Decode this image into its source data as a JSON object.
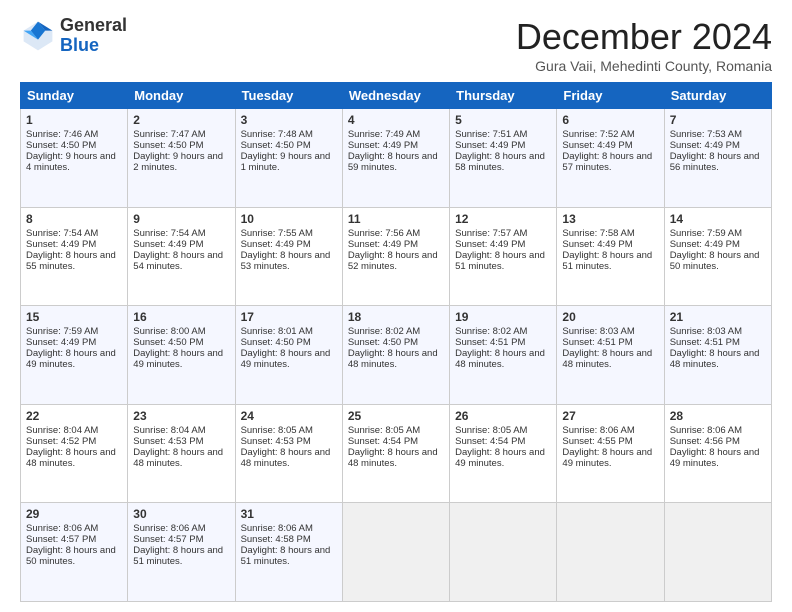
{
  "header": {
    "logo_general": "General",
    "logo_blue": "Blue",
    "month_title": "December 2024",
    "subtitle": "Gura Vaii, Mehedinti County, Romania"
  },
  "weekdays": [
    "Sunday",
    "Monday",
    "Tuesday",
    "Wednesday",
    "Thursday",
    "Friday",
    "Saturday"
  ],
  "weeks": [
    [
      {
        "day": "1",
        "sunrise": "Sunrise: 7:46 AM",
        "sunset": "Sunset: 4:50 PM",
        "daylight": "Daylight: 9 hours and 4 minutes."
      },
      {
        "day": "2",
        "sunrise": "Sunrise: 7:47 AM",
        "sunset": "Sunset: 4:50 PM",
        "daylight": "Daylight: 9 hours and 2 minutes."
      },
      {
        "day": "3",
        "sunrise": "Sunrise: 7:48 AM",
        "sunset": "Sunset: 4:50 PM",
        "daylight": "Daylight: 9 hours and 1 minute."
      },
      {
        "day": "4",
        "sunrise": "Sunrise: 7:49 AM",
        "sunset": "Sunset: 4:49 PM",
        "daylight": "Daylight: 8 hours and 59 minutes."
      },
      {
        "day": "5",
        "sunrise": "Sunrise: 7:51 AM",
        "sunset": "Sunset: 4:49 PM",
        "daylight": "Daylight: 8 hours and 58 minutes."
      },
      {
        "day": "6",
        "sunrise": "Sunrise: 7:52 AM",
        "sunset": "Sunset: 4:49 PM",
        "daylight": "Daylight: 8 hours and 57 minutes."
      },
      {
        "day": "7",
        "sunrise": "Sunrise: 7:53 AM",
        "sunset": "Sunset: 4:49 PM",
        "daylight": "Daylight: 8 hours and 56 minutes."
      }
    ],
    [
      {
        "day": "8",
        "sunrise": "Sunrise: 7:54 AM",
        "sunset": "Sunset: 4:49 PM",
        "daylight": "Daylight: 8 hours and 55 minutes."
      },
      {
        "day": "9",
        "sunrise": "Sunrise: 7:54 AM",
        "sunset": "Sunset: 4:49 PM",
        "daylight": "Daylight: 8 hours and 54 minutes."
      },
      {
        "day": "10",
        "sunrise": "Sunrise: 7:55 AM",
        "sunset": "Sunset: 4:49 PM",
        "daylight": "Daylight: 8 hours and 53 minutes."
      },
      {
        "day": "11",
        "sunrise": "Sunrise: 7:56 AM",
        "sunset": "Sunset: 4:49 PM",
        "daylight": "Daylight: 8 hours and 52 minutes."
      },
      {
        "day": "12",
        "sunrise": "Sunrise: 7:57 AM",
        "sunset": "Sunset: 4:49 PM",
        "daylight": "Daylight: 8 hours and 51 minutes."
      },
      {
        "day": "13",
        "sunrise": "Sunrise: 7:58 AM",
        "sunset": "Sunset: 4:49 PM",
        "daylight": "Daylight: 8 hours and 51 minutes."
      },
      {
        "day": "14",
        "sunrise": "Sunrise: 7:59 AM",
        "sunset": "Sunset: 4:49 PM",
        "daylight": "Daylight: 8 hours and 50 minutes."
      }
    ],
    [
      {
        "day": "15",
        "sunrise": "Sunrise: 7:59 AM",
        "sunset": "Sunset: 4:49 PM",
        "daylight": "Daylight: 8 hours and 49 minutes."
      },
      {
        "day": "16",
        "sunrise": "Sunrise: 8:00 AM",
        "sunset": "Sunset: 4:50 PM",
        "daylight": "Daylight: 8 hours and 49 minutes."
      },
      {
        "day": "17",
        "sunrise": "Sunrise: 8:01 AM",
        "sunset": "Sunset: 4:50 PM",
        "daylight": "Daylight: 8 hours and 49 minutes."
      },
      {
        "day": "18",
        "sunrise": "Sunrise: 8:02 AM",
        "sunset": "Sunset: 4:50 PM",
        "daylight": "Daylight: 8 hours and 48 minutes."
      },
      {
        "day": "19",
        "sunrise": "Sunrise: 8:02 AM",
        "sunset": "Sunset: 4:51 PM",
        "daylight": "Daylight: 8 hours and 48 minutes."
      },
      {
        "day": "20",
        "sunrise": "Sunrise: 8:03 AM",
        "sunset": "Sunset: 4:51 PM",
        "daylight": "Daylight: 8 hours and 48 minutes."
      },
      {
        "day": "21",
        "sunrise": "Sunrise: 8:03 AM",
        "sunset": "Sunset: 4:51 PM",
        "daylight": "Daylight: 8 hours and 48 minutes."
      }
    ],
    [
      {
        "day": "22",
        "sunrise": "Sunrise: 8:04 AM",
        "sunset": "Sunset: 4:52 PM",
        "daylight": "Daylight: 8 hours and 48 minutes."
      },
      {
        "day": "23",
        "sunrise": "Sunrise: 8:04 AM",
        "sunset": "Sunset: 4:53 PM",
        "daylight": "Daylight: 8 hours and 48 minutes."
      },
      {
        "day": "24",
        "sunrise": "Sunrise: 8:05 AM",
        "sunset": "Sunset: 4:53 PM",
        "daylight": "Daylight: 8 hours and 48 minutes."
      },
      {
        "day": "25",
        "sunrise": "Sunrise: 8:05 AM",
        "sunset": "Sunset: 4:54 PM",
        "daylight": "Daylight: 8 hours and 48 minutes."
      },
      {
        "day": "26",
        "sunrise": "Sunrise: 8:05 AM",
        "sunset": "Sunset: 4:54 PM",
        "daylight": "Daylight: 8 hours and 49 minutes."
      },
      {
        "day": "27",
        "sunrise": "Sunrise: 8:06 AM",
        "sunset": "Sunset: 4:55 PM",
        "daylight": "Daylight: 8 hours and 49 minutes."
      },
      {
        "day": "28",
        "sunrise": "Sunrise: 8:06 AM",
        "sunset": "Sunset: 4:56 PM",
        "daylight": "Daylight: 8 hours and 49 minutes."
      }
    ],
    [
      {
        "day": "29",
        "sunrise": "Sunrise: 8:06 AM",
        "sunset": "Sunset: 4:57 PM",
        "daylight": "Daylight: 8 hours and 50 minutes."
      },
      {
        "day": "30",
        "sunrise": "Sunrise: 8:06 AM",
        "sunset": "Sunset: 4:57 PM",
        "daylight": "Daylight: 8 hours and 51 minutes."
      },
      {
        "day": "31",
        "sunrise": "Sunrise: 8:06 AM",
        "sunset": "Sunset: 4:58 PM",
        "daylight": "Daylight: 8 hours and 51 minutes."
      },
      null,
      null,
      null,
      null
    ]
  ]
}
